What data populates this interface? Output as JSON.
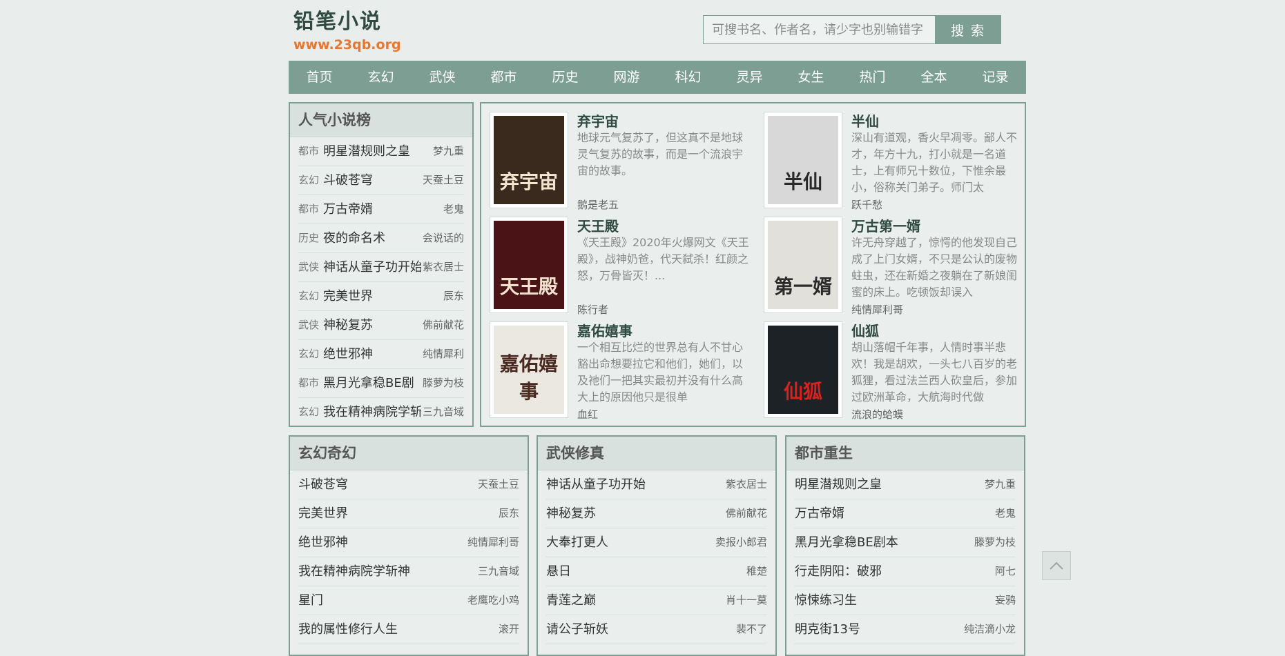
{
  "header": {
    "logo_title": "铅笔小说",
    "logo_url": "www.23qb.org",
    "search_placeholder": "可搜书名、作者名，请少字也别输错字",
    "search_button": "搜 索"
  },
  "nav": [
    "首页",
    "玄幻",
    "武侠",
    "都市",
    "历史",
    "网游",
    "科幻",
    "灵异",
    "女生",
    "热门",
    "全本",
    "记录"
  ],
  "rank": {
    "title": "人气小说榜",
    "items": [
      {
        "cat": "都市",
        "name": "明星潜规则之皇",
        "author": "梦九重"
      },
      {
        "cat": "玄幻",
        "name": "斗破苍穹",
        "author": "天蚕土豆"
      },
      {
        "cat": "都市",
        "name": "万古帝婿",
        "author": "老鬼"
      },
      {
        "cat": "历史",
        "name": "夜的命名术",
        "author": "会说话的"
      },
      {
        "cat": "武侠",
        "name": "神话从童子功开始",
        "author": "紫衣居士"
      },
      {
        "cat": "玄幻",
        "name": "完美世界",
        "author": "辰东"
      },
      {
        "cat": "武侠",
        "name": "神秘复苏",
        "author": "佛前献花"
      },
      {
        "cat": "玄幻",
        "name": "绝世邪神",
        "author": "纯情犀利"
      },
      {
        "cat": "都市",
        "name": "黑月光拿稳BE剧",
        "author": "滕萝为枝"
      },
      {
        "cat": "玄幻",
        "name": "我在精神病院学斩",
        "author": "三九音域"
      }
    ]
  },
  "featured": [
    {
      "title": "弃宇宙",
      "desc": "地球元气复苏了，但这真不是地球灵气复苏的故事，而是一个流浪宇宙的故事。",
      "author": "鹅是老五",
      "cover_text": "弃宇宙",
      "cover_bg": "#3a2a1e",
      "cover_color": "#f2e6cf"
    },
    {
      "title": "半仙",
      "desc": "深山有道观，香火早凋零。鄙人不才，年方十九，打小就是一名道士，上有师兄十数位，下惟余最小，俗称关门弟子。师门太",
      "author": "跃千愁",
      "cover_text": "半仙",
      "cover_bg": "#d8d8d8",
      "cover_color": "#2a2a2a"
    },
    {
      "title": "天王殿",
      "desc": "《天王殿》2020年火爆网文《天王殿》，战神奶爸，代天弑杀！红颜之怒，万骨皆灭！...",
      "author": "陈行者",
      "cover_text": "天王殿",
      "cover_bg": "#4a1416",
      "cover_color": "#f4e2d0"
    },
    {
      "title": "万古第一婿",
      "desc": "许无舟穿越了，惊愕的他发现自己成了上门女婿，不只是公认的废物蛀虫，还在新婚之夜躺在了新娘闺蜜的床上。吃顿饭却误入",
      "author": "纯情犀利哥",
      "cover_text": "第一婿",
      "cover_bg": "#e2e0da",
      "cover_color": "#2b2b2b"
    },
    {
      "title": "嘉佑嬉事",
      "desc": "一个相互比烂的世界总有人不甘心豁出命想要拉它和他们，她们，以及祂们一把其实最初并没有什么高大上的原因他只是很单",
      "author": "血红",
      "cover_text": "嘉佑嬉事",
      "cover_bg": "#ebe8e2",
      "cover_color": "#4a2a20"
    },
    {
      "title": "仙狐",
      "desc": "胡山落帽千年事，人情时事半悲欢！我是胡欢，一头七八百岁的老狐狸，看过法兰西人砍皇后，参加过欧洲革命，大航海时代做",
      "author": "流浪的蛤蟆",
      "cover_text": "仙狐",
      "cover_bg": "#1c2226",
      "cover_color": "#d8221f"
    }
  ],
  "categories": [
    {
      "title": "玄幻奇幻",
      "items": [
        {
          "name": "斗破苍穹",
          "author": "天蚕土豆"
        },
        {
          "name": "完美世界",
          "author": "辰东"
        },
        {
          "name": "绝世邪神",
          "author": "纯情犀利哥"
        },
        {
          "name": "我在精神病院学斩神",
          "author": "三九音域"
        },
        {
          "name": "星门",
          "author": "老鹰吃小鸡"
        },
        {
          "name": "我的属性修行人生",
          "author": "滚开"
        }
      ]
    },
    {
      "title": "武侠修真",
      "items": [
        {
          "name": "神话从童子功开始",
          "author": "紫衣居士"
        },
        {
          "name": "神秘复苏",
          "author": "佛前献花"
        },
        {
          "name": "大奉打更人",
          "author": "卖报小郎君"
        },
        {
          "name": "悬日",
          "author": "稚楚"
        },
        {
          "name": "青莲之巅",
          "author": "肖十一莫"
        },
        {
          "name": "请公子斩妖",
          "author": "裴不了"
        }
      ]
    },
    {
      "title": "都市重生",
      "items": [
        {
          "name": "明星潜规则之皇",
          "author": "梦九重"
        },
        {
          "name": "万古帝婿",
          "author": "老鬼"
        },
        {
          "name": "黑月光拿稳BE剧本",
          "author": "滕萝为枝"
        },
        {
          "name": "行走阴阳：破邪",
          "author": "阿七"
        },
        {
          "name": "惊悚练习生",
          "author": "妄鸦"
        },
        {
          "name": "明克街13号",
          "author": "纯洁滴小龙"
        }
      ]
    }
  ],
  "colors": {
    "accent": "#7d9e92",
    "logo_url": "#e8762d",
    "title": "#2f4a41"
  },
  "icons": {
    "back_to_top": "chevron-up-icon"
  }
}
